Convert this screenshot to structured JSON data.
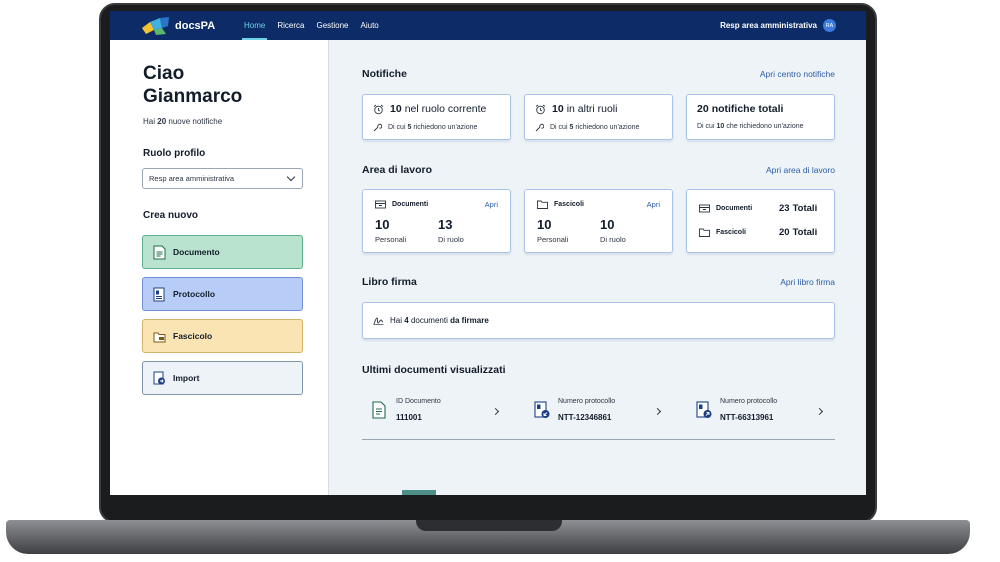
{
  "app": {
    "logo_text": "docsPA"
  },
  "nav": {
    "items": [
      "Home",
      "Ricerca",
      "Gestione",
      "Aiuto"
    ],
    "active": "Home"
  },
  "user": {
    "role": "Resp area amministrativa",
    "initials": "RA"
  },
  "left": {
    "greeting_line1": "Ciao",
    "greeting_line2": "Gianmarco",
    "notif_prefix": "Hai",
    "notif_count": "20",
    "notif_suffix": "nuove notifiche",
    "role_profile_title": "Ruolo profilo",
    "role_select_value": "Resp area amministrativa",
    "create_title": "Crea nuovo",
    "create_buttons": [
      {
        "label": "Documento",
        "color": "#b9e2cf",
        "border": "#5fae8c"
      },
      {
        "label": "Protocollo",
        "color": "#b7cdf7",
        "border": "#6f8fd6"
      },
      {
        "label": "Fascicolo",
        "color": "#fbe4b3",
        "border": "#d4b26a"
      },
      {
        "label": "Import",
        "color": "#eef3f7",
        "border": "#7e94ac"
      }
    ]
  },
  "notifiche": {
    "title": "Notifiche",
    "link": "Apri centro notifiche",
    "cards": [
      {
        "count": "10",
        "text": "nel ruolo corrente",
        "sub_prefix": "Di cui",
        "sub_count": "5",
        "sub_suffix": "richiedono un'azione"
      },
      {
        "count": "10",
        "text": "in altri ruoli",
        "sub_prefix": "Di cui",
        "sub_count": "5",
        "sub_suffix": "richiedono un'azione"
      },
      {
        "count": "20",
        "text": "notifiche totali",
        "sub_prefix": "Di cui",
        "sub_count": "10",
        "sub_suffix": "che richiedono un'azione"
      }
    ]
  },
  "area": {
    "title": "Area di lavoro",
    "link": "Apri area di lavoro",
    "documenti": {
      "label": "Documenti",
      "open": "Apri",
      "personali": "10",
      "personali_label": "Personali",
      "ruolo": "13",
      "ruolo_label": "Di ruolo"
    },
    "fascicoli": {
      "label": "Fascicoli",
      "open": "Apri",
      "personali": "10",
      "personali_label": "Personali",
      "ruolo": "10",
      "ruolo_label": "Di ruolo"
    },
    "totali": [
      {
        "label": "Documenti",
        "value": "23",
        "suffix": "Totali"
      },
      {
        "label": "Fascicoli",
        "value": "20",
        "suffix": "Totali"
      }
    ]
  },
  "libro": {
    "title": "Libro firma",
    "link": "Apri libro firma",
    "text_prefix": "Hai",
    "count": "4",
    "text_mid": "documenti",
    "text_bold": "da firmare"
  },
  "recenti": {
    "title": "Ultimi documenti visualizzati",
    "items": [
      {
        "label": "ID Documento",
        "value": "111001",
        "icon": "document-icon"
      },
      {
        "label": "Numero protocollo",
        "value": "NTT-12346861",
        "icon": "protocol-incoming-icon"
      },
      {
        "label": "Numero protocollo",
        "value": "NTT-66313961",
        "icon": "protocol-outgoing-icon"
      }
    ]
  }
}
